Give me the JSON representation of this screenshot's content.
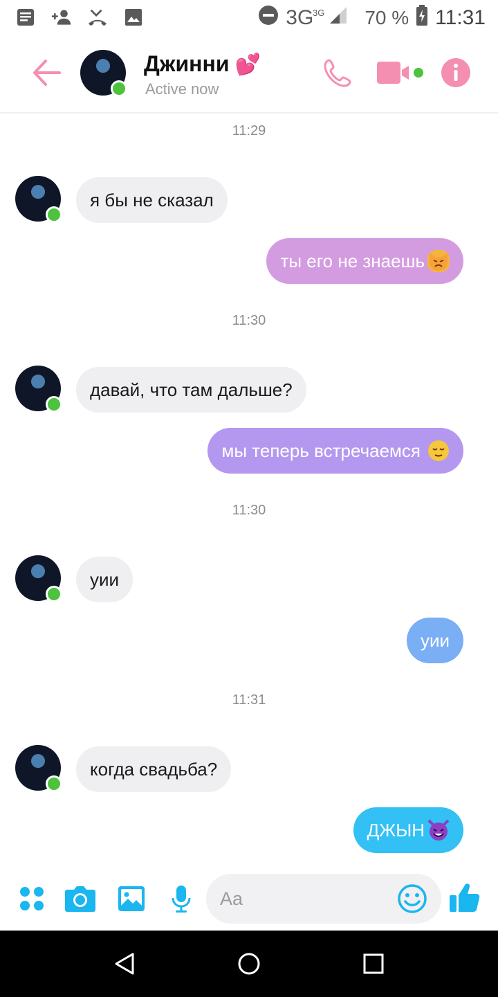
{
  "status_bar": {
    "network": "3G",
    "network_sup": "3G",
    "battery": "70 %",
    "time": "11:31"
  },
  "header": {
    "contact_name": "Джинни",
    "contact_emoji": "💕",
    "status": "Active now"
  },
  "messages": [
    {
      "type": "timestamp",
      "text": "11:29"
    },
    {
      "type": "in",
      "text": "я бы не сказал"
    },
    {
      "type": "out",
      "text": "ты его не знаешь",
      "emoji": "pouting-cat",
      "color": "#d49ce0"
    },
    {
      "type": "timestamp",
      "text": "11:30"
    },
    {
      "type": "in",
      "text": "давай, что там дальше?"
    },
    {
      "type": "out",
      "text": "мы теперь встречаемся",
      "emoji": "relieved-face",
      "color": "#b497ef"
    },
    {
      "type": "timestamp",
      "text": "11:30"
    },
    {
      "type": "in",
      "text": "уии"
    },
    {
      "type": "out",
      "text": "уии",
      "color": "#7aaef5"
    },
    {
      "type": "timestamp",
      "text": "11:31"
    },
    {
      "type": "in",
      "text": "когда свадьба?"
    },
    {
      "type": "out",
      "text": "ДЖЫН",
      "emoji": "smiling-imp",
      "color": "#32c0f5"
    }
  ],
  "composer": {
    "placeholder": "Aa"
  },
  "colors": {
    "accent_pink": "#f28db0",
    "accent_blue": "#19b6ef",
    "online": "#4cc23d"
  }
}
